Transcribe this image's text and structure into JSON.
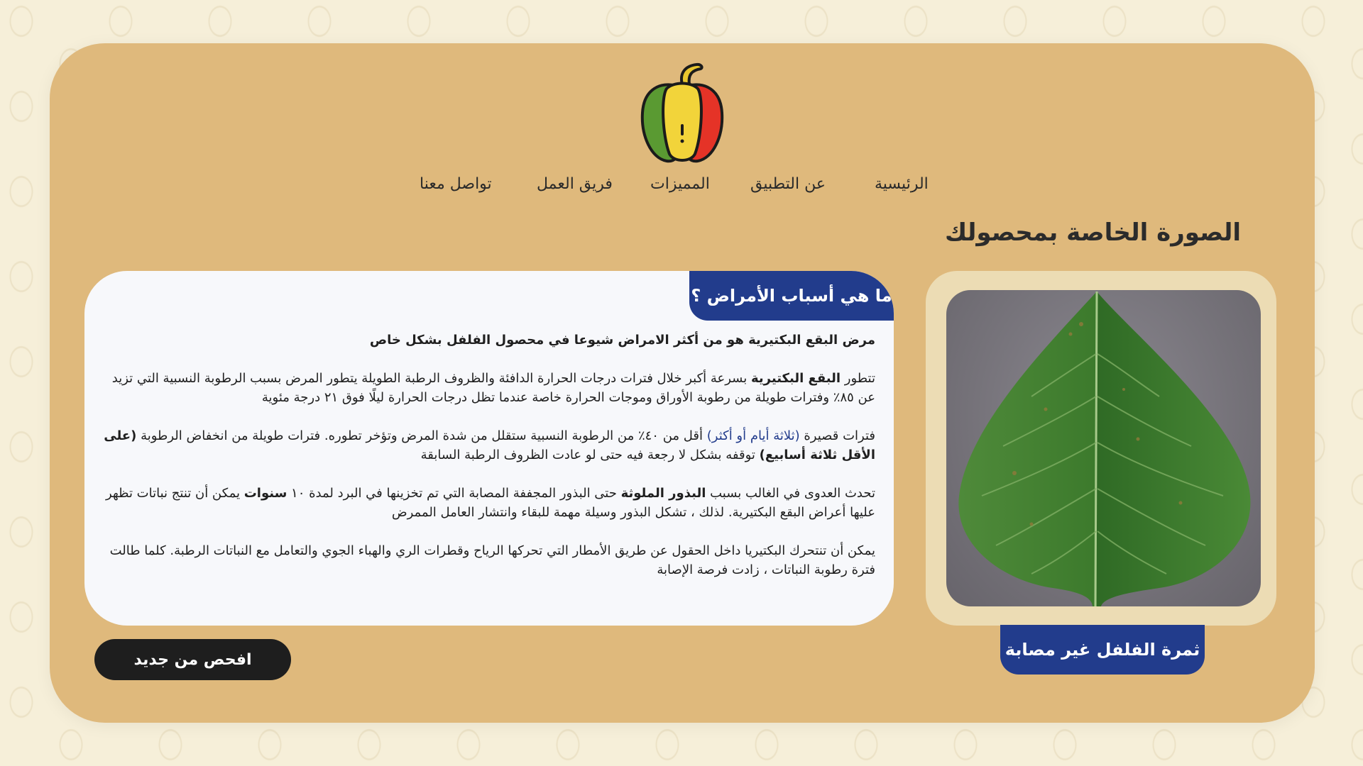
{
  "nav": {
    "home": "الرئيسية",
    "about": "عن التطبيق",
    "features": "المميزات",
    "team": "فريق العمل",
    "contact": "تواصل معنا"
  },
  "section_title": "الصورة الخاصة بمحصولك",
  "image_label": "ثمرة الفلفل غير مصابة",
  "info": {
    "tab_title": "ما هي أسباب الأمراض ؟",
    "p1": "مرض البقع البكتيرية هو من أكثر الامراض شيوعا في محصول الفلفل بشكل خاص",
    "p2_a": "تتطور ",
    "p2_b": "البقع البكتيرية",
    "p2_c": " بسرعة أكبر خلال فترات درجات الحرارة الدافئة والظروف الرطبة الطويلة يتطور المرض بسبب الرطوبة النسبية التي تزيد عن ٨٥٪ وفترات طويلة من رطوبة الأوراق وموجات الحرارة خاصة عندما تظل درجات الحرارة ليلًا فوق ٢١ درجة مئوية",
    "p3_a": "فترات قصيرة ",
    "p3_b": "(ثلاثة أيام أو أكثر)",
    "p3_c": " أقل من ٤٠٪ من الرطوبة النسبية ستقلل من شدة المرض وتؤخر تطوره. فترات طويلة من انخفاض الرطوبة ",
    "p3_d": "(على الأقل ثلاثة أسابيع)",
    "p3_e": " توقفه بشكل لا رجعة فيه حتى لو عادت الظروف الرطبة السابقة",
    "p4_a": "تحدث العدوى في الغالب بسبب ",
    "p4_b": "البذور الملوثة",
    "p4_c": " حتى البذور المجففة المصابة التي تم تخزينها في البرد لمدة ١٠ ",
    "p4_d": "سنوات",
    "p4_e": " يمكن أن تنتج نباتات تظهر عليها أعراض البقع البكتيرية. لذلك ، تشكل البذور وسيلة مهمة للبقاء وانتشار العامل الممرض",
    "p5": "يمكن أن تنتحرك البكتيريا داخل الحقول عن طريق الأمطار التي تحركها الرياح وقطرات الري والهباء الجوي والتعامل مع النباتات الرطبة. كلما طالت فترة رطوبة النباتات ، زادت فرصة الإصابة"
  },
  "recheck_button": "افحص من جديد",
  "colors": {
    "card": "#dfb97c",
    "accent_blue": "#223c8c",
    "button_dark": "#1e1e1e",
    "background": "#f6efd9"
  }
}
